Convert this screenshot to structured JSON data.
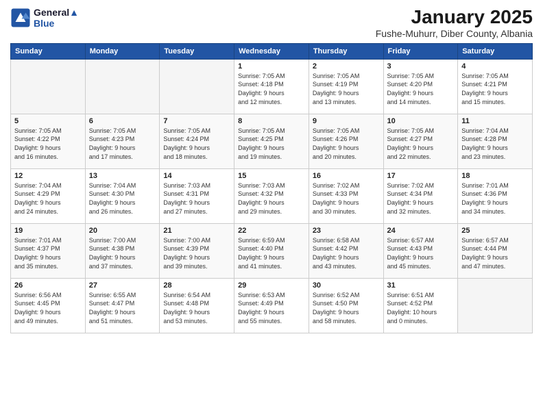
{
  "logo": {
    "line1": "General",
    "line2": "Blue"
  },
  "title": "January 2025",
  "location": "Fushe-Muhurr, Diber County, Albania",
  "days_of_week": [
    "Sunday",
    "Monday",
    "Tuesday",
    "Wednesday",
    "Thursday",
    "Friday",
    "Saturday"
  ],
  "weeks": [
    [
      {
        "day": "",
        "info": ""
      },
      {
        "day": "",
        "info": ""
      },
      {
        "day": "",
        "info": ""
      },
      {
        "day": "1",
        "info": "Sunrise: 7:05 AM\nSunset: 4:18 PM\nDaylight: 9 hours\nand 12 minutes."
      },
      {
        "day": "2",
        "info": "Sunrise: 7:05 AM\nSunset: 4:19 PM\nDaylight: 9 hours\nand 13 minutes."
      },
      {
        "day": "3",
        "info": "Sunrise: 7:05 AM\nSunset: 4:20 PM\nDaylight: 9 hours\nand 14 minutes."
      },
      {
        "day": "4",
        "info": "Sunrise: 7:05 AM\nSunset: 4:21 PM\nDaylight: 9 hours\nand 15 minutes."
      }
    ],
    [
      {
        "day": "5",
        "info": "Sunrise: 7:05 AM\nSunset: 4:22 PM\nDaylight: 9 hours\nand 16 minutes."
      },
      {
        "day": "6",
        "info": "Sunrise: 7:05 AM\nSunset: 4:23 PM\nDaylight: 9 hours\nand 17 minutes."
      },
      {
        "day": "7",
        "info": "Sunrise: 7:05 AM\nSunset: 4:24 PM\nDaylight: 9 hours\nand 18 minutes."
      },
      {
        "day": "8",
        "info": "Sunrise: 7:05 AM\nSunset: 4:25 PM\nDaylight: 9 hours\nand 19 minutes."
      },
      {
        "day": "9",
        "info": "Sunrise: 7:05 AM\nSunset: 4:26 PM\nDaylight: 9 hours\nand 20 minutes."
      },
      {
        "day": "10",
        "info": "Sunrise: 7:05 AM\nSunset: 4:27 PM\nDaylight: 9 hours\nand 22 minutes."
      },
      {
        "day": "11",
        "info": "Sunrise: 7:04 AM\nSunset: 4:28 PM\nDaylight: 9 hours\nand 23 minutes."
      }
    ],
    [
      {
        "day": "12",
        "info": "Sunrise: 7:04 AM\nSunset: 4:29 PM\nDaylight: 9 hours\nand 24 minutes."
      },
      {
        "day": "13",
        "info": "Sunrise: 7:04 AM\nSunset: 4:30 PM\nDaylight: 9 hours\nand 26 minutes."
      },
      {
        "day": "14",
        "info": "Sunrise: 7:03 AM\nSunset: 4:31 PM\nDaylight: 9 hours\nand 27 minutes."
      },
      {
        "day": "15",
        "info": "Sunrise: 7:03 AM\nSunset: 4:32 PM\nDaylight: 9 hours\nand 29 minutes."
      },
      {
        "day": "16",
        "info": "Sunrise: 7:02 AM\nSunset: 4:33 PM\nDaylight: 9 hours\nand 30 minutes."
      },
      {
        "day": "17",
        "info": "Sunrise: 7:02 AM\nSunset: 4:34 PM\nDaylight: 9 hours\nand 32 minutes."
      },
      {
        "day": "18",
        "info": "Sunrise: 7:01 AM\nSunset: 4:36 PM\nDaylight: 9 hours\nand 34 minutes."
      }
    ],
    [
      {
        "day": "19",
        "info": "Sunrise: 7:01 AM\nSunset: 4:37 PM\nDaylight: 9 hours\nand 35 minutes."
      },
      {
        "day": "20",
        "info": "Sunrise: 7:00 AM\nSunset: 4:38 PM\nDaylight: 9 hours\nand 37 minutes."
      },
      {
        "day": "21",
        "info": "Sunrise: 7:00 AM\nSunset: 4:39 PM\nDaylight: 9 hours\nand 39 minutes."
      },
      {
        "day": "22",
        "info": "Sunrise: 6:59 AM\nSunset: 4:40 PM\nDaylight: 9 hours\nand 41 minutes."
      },
      {
        "day": "23",
        "info": "Sunrise: 6:58 AM\nSunset: 4:42 PM\nDaylight: 9 hours\nand 43 minutes."
      },
      {
        "day": "24",
        "info": "Sunrise: 6:57 AM\nSunset: 4:43 PM\nDaylight: 9 hours\nand 45 minutes."
      },
      {
        "day": "25",
        "info": "Sunrise: 6:57 AM\nSunset: 4:44 PM\nDaylight: 9 hours\nand 47 minutes."
      }
    ],
    [
      {
        "day": "26",
        "info": "Sunrise: 6:56 AM\nSunset: 4:45 PM\nDaylight: 9 hours\nand 49 minutes."
      },
      {
        "day": "27",
        "info": "Sunrise: 6:55 AM\nSunset: 4:47 PM\nDaylight: 9 hours\nand 51 minutes."
      },
      {
        "day": "28",
        "info": "Sunrise: 6:54 AM\nSunset: 4:48 PM\nDaylight: 9 hours\nand 53 minutes."
      },
      {
        "day": "29",
        "info": "Sunrise: 6:53 AM\nSunset: 4:49 PM\nDaylight: 9 hours\nand 55 minutes."
      },
      {
        "day": "30",
        "info": "Sunrise: 6:52 AM\nSunset: 4:50 PM\nDaylight: 9 hours\nand 58 minutes."
      },
      {
        "day": "31",
        "info": "Sunrise: 6:51 AM\nSunset: 4:52 PM\nDaylight: 10 hours\nand 0 minutes."
      },
      {
        "day": "",
        "info": ""
      }
    ]
  ]
}
